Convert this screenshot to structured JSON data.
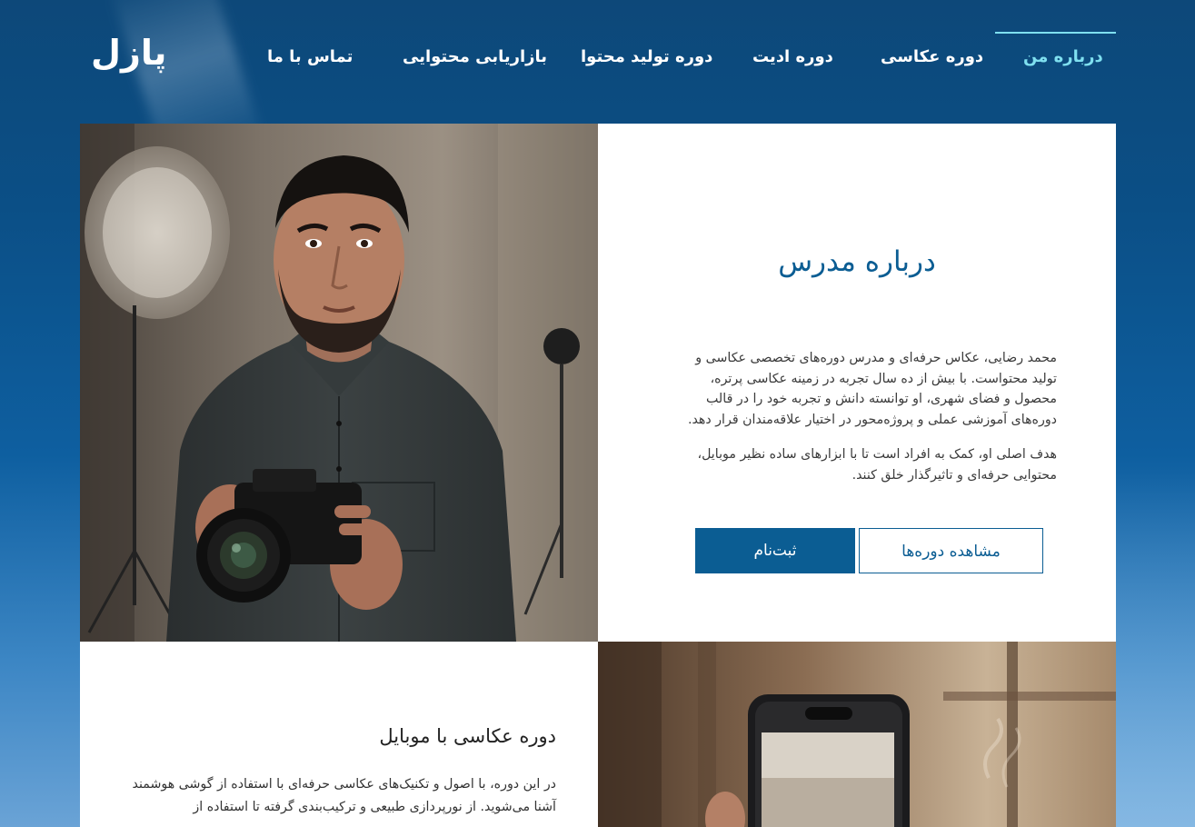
{
  "site": {
    "logo": "پازل"
  },
  "nav": {
    "items": [
      {
        "label": "درباره من",
        "active": true
      },
      {
        "label": "دوره عکاسی",
        "active": false
      },
      {
        "label": "دوره ادیت",
        "active": false
      },
      {
        "label": "دوره تولید محتوا",
        "active": false
      },
      {
        "label": "بازاریابی محتوایی",
        "active": false
      },
      {
        "label": "تماس با ما",
        "active": false
      }
    ]
  },
  "about": {
    "title": "درباره مدرس",
    "paragraph1": "محمد رضایی، عکاس حرفه‌ای و مدرس دوره‌های تخصصی عکاسی و تولید محتواست. با بیش از ده سال تجربه در زمینه عکاسی پرتره، محصول و فضای شهری، او توانسته دانش و تجربه خود را در قالب دوره‌های آموزشی عملی و پروژه‌محور در اختیار علاقه‌مندان قرار دهد.",
    "paragraph2": "هدف اصلی او، کمک به افراد است تا با ابزارهای ساده نظیر موبایل، محتوایی حرفه‌ای و تاثیرگذار خلق کنند.",
    "buttons": {
      "secondary": "مشاهده دوره‌ها",
      "primary": "ثبت‌نام"
    },
    "photo_alt": "photographer-portrait"
  },
  "course": {
    "title": "دوره عکاسی با موبایل",
    "text": "در این دوره، با اصول و تکنیک‌های عکاسی حرفه‌ای با استفاده از گوشی هوشمند آشنا می‌شوید. از نورپردازی طبیعی و ترکیب‌بندی گرفته تا استفاده از"
  },
  "colors": {
    "accent": "#0b5d93",
    "nav_active": "#7fe0f0",
    "card_bg": "#ffffff"
  }
}
